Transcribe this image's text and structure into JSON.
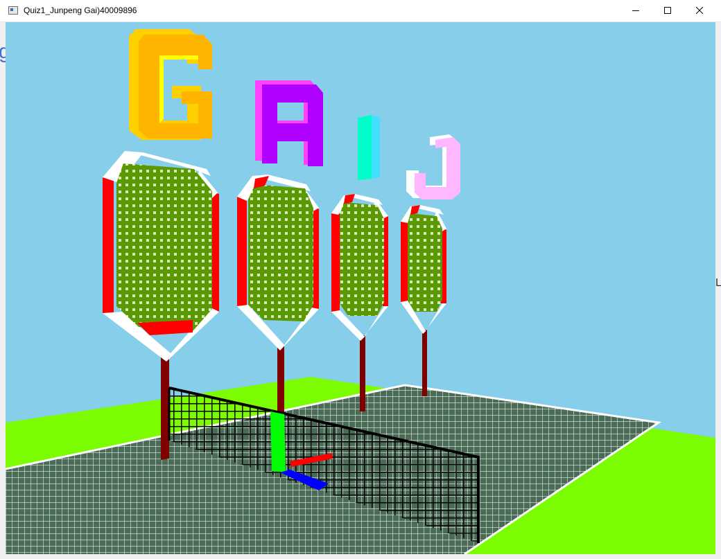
{
  "window": {
    "title": "Quiz1_Junpeng Gai)40009896",
    "controls": {
      "minimize": "minimize",
      "maximize": "maximize",
      "close": "close"
    }
  },
  "scene": {
    "background": "#87ceeb",
    "letters": [
      {
        "char": "G",
        "front": "#ffb400",
        "side": "#ffff00"
      },
      {
        "char": "A",
        "front": "#b000ff",
        "side": "#ff40ff"
      },
      {
        "char": "I",
        "front": "#00ffc8",
        "side": "#40e0ff"
      },
      {
        "char": "J",
        "front": "#ffb8ff",
        "side": "#ffffff"
      }
    ],
    "racket_colors": {
      "frame": "#ff0000",
      "accent": "#ffffff",
      "strings": "#5a9a00",
      "handle": "#800000"
    },
    "court_color": "#4a6b55",
    "grass_color": "#7cfc00",
    "net_color": "#000000",
    "net_post_color": "#00ff00"
  },
  "background_fragments": {
    "left": "g",
    "right": "L"
  }
}
